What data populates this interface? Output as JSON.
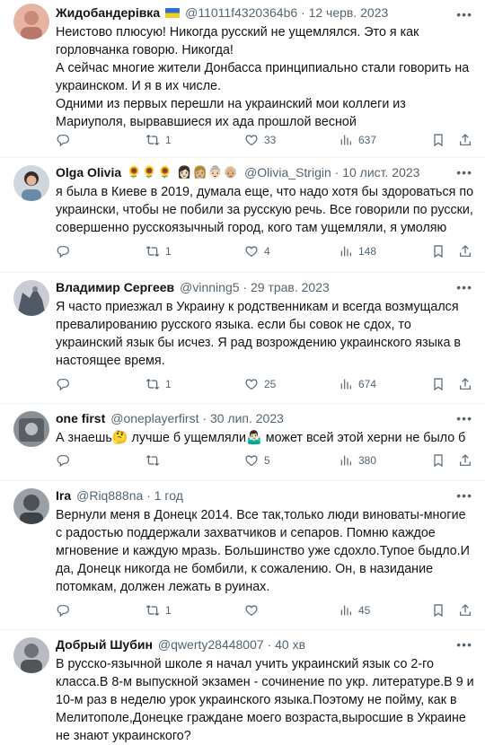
{
  "tweets": [
    {
      "name": "Жидобандерівка",
      "handle": "@11011f4320364b6",
      "date": "12 черв. 2023",
      "text": "Неистово плюсую! Никогда русский не ущемлялся. Это я как горловчанка говорю. Никогда!\nА сейчас многие жители Донбасса принципиально стали говорить на украинском. И я в их числе.\nОдними из первых перешли на украинский мои коллеги из Мариуполя, вырвавшиеся их ада прошлой весной",
      "replies": "",
      "retweets": "1",
      "likes": "33",
      "views": "637"
    },
    {
      "name": "Olga Olivia",
      "flags": "🌻🌻🌻 👩🏻👩🏼👵🏻👴🏼",
      "handle": "@Olivia_Strigin",
      "date": "10 лист. 2023",
      "text": "я была в Киеве в 2019, думала еще, что надо хотя бы здороваться по украински, чтобы не побили за русскую речь. Все говорили по русски, совершенно русскоязычный город, кого там ущемляли, я умоляю",
      "replies": "",
      "retweets": "1",
      "likes": "4",
      "views": "148"
    },
    {
      "name": "Владимир Сергеев",
      "handle": "@vinning5",
      "date": "29 трав. 2023",
      "text": "Я часто приезжал в Украину к родственникам и всегда возмущался превалированию русского языка. если бы совок не сдох, то украинский язык бы исчез. Я рад возрождению украинского языка в настоящее время.",
      "replies": "",
      "retweets": "1",
      "likes": "25",
      "views": "674"
    },
    {
      "name": "one first",
      "handle": "@oneplayerfirst",
      "date": "30 лип. 2023",
      "text": "А знаешь🤔 лучше б ущемляли🤷🏻‍♂️ может всей этой херни не было б",
      "replies": "",
      "retweets": "",
      "likes": "5",
      "views": "380"
    },
    {
      "name": "Ira",
      "handle": "@Riq888na",
      "date": "1 год",
      "text": "Вернули меня в Донецк 2014. Все так,только люди виноваты-многие с радостью поддержали захватчиков и сепаров. Помню каждое мгновение и каждую мразь. Большинство уже сдохло.Тупое быдло.И да, Донецк никогда не бомбили, к сожалению. Он, в назидание потомкам, должен лежать в руинах.",
      "replies": "",
      "retweets": "1",
      "likes": "",
      "views": "45"
    },
    {
      "name": "Добрый Шубин",
      "handle": "@qwerty28448007",
      "date": "40 хв",
      "text": "В русско-язычной школе я начал учить украинский язык со 2-го класса.В 8-м выпускной экзамен - сочинение по укр. литературе.В 9 и 10-м раз в неделю урок украинского языка.Поэтому не пойму, как в Мелитополе,Донецке граждане моего возраста,выросшие в Украине не знают украинского?",
      "replies": "",
      "retweets": "",
      "likes": "",
      "views": ""
    }
  ],
  "icons": {
    "reply": "reply-icon",
    "retweet": "retweet-icon",
    "like": "heart-icon",
    "views": "views-icon",
    "bookmark": "bookmark-icon",
    "share": "share-icon",
    "more": "more-icon"
  },
  "colors": {
    "text": "#0f1419",
    "secondary": "#536471",
    "divider": "#eff3f4"
  }
}
